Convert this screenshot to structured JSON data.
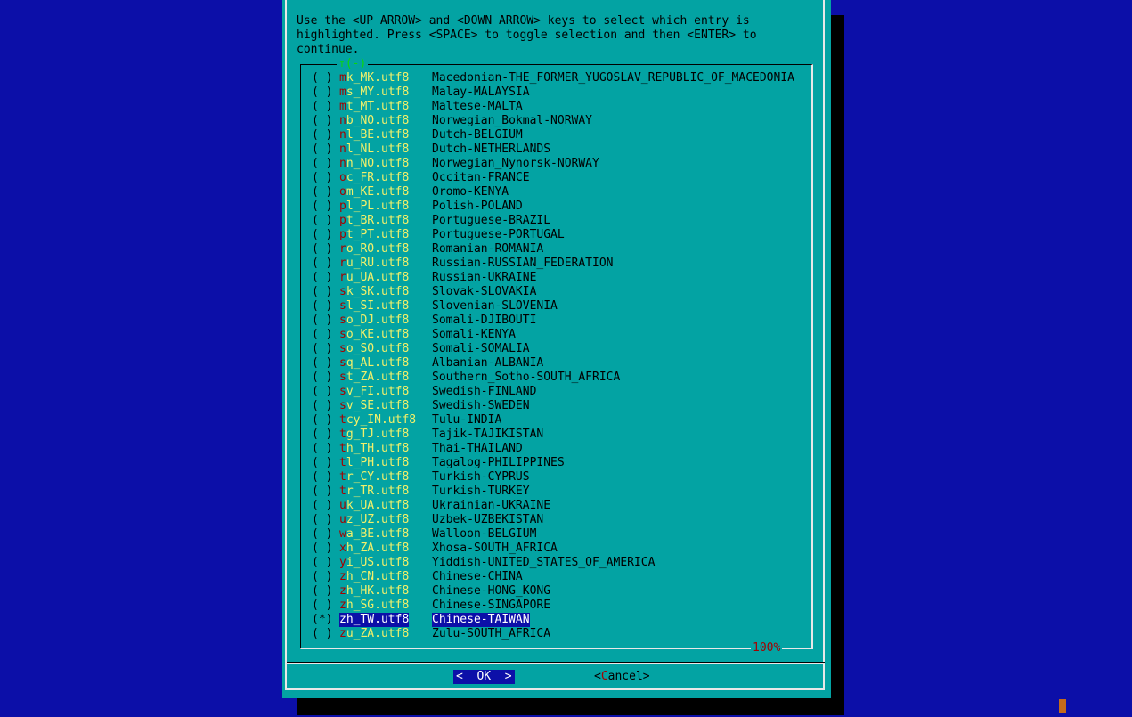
{
  "prompt": "Use the <UP ARROW> and <DOWN ARROW> keys to select which entry is\nhighlighted. Press <SPACE> to toggle selection and then <ENTER> to\ncontinue.",
  "scroll_indicator": "↑(-)",
  "percent": "100%",
  "buttons": {
    "ok": "<  OK  >",
    "cancel_open": "<",
    "cancel_hot": "C",
    "cancel_rest": "ancel>"
  },
  "items": [
    {
      "check": "( )",
      "hot": "m",
      "tag": "k_MK.utf8",
      "desc": "Macedonian-THE_FORMER_YUGOSLAV_REPUBLIC_OF_MACEDONIA"
    },
    {
      "check": "( )",
      "hot": "m",
      "tag": "s_MY.utf8",
      "desc": "Malay-MALAYSIA"
    },
    {
      "check": "( )",
      "hot": "m",
      "tag": "t_MT.utf8",
      "desc": "Maltese-MALTA"
    },
    {
      "check": "( )",
      "hot": "n",
      "tag": "b_NO.utf8",
      "desc": "Norwegian_Bokmal-NORWAY"
    },
    {
      "check": "( )",
      "hot": "n",
      "tag": "l_BE.utf8",
      "desc": "Dutch-BELGIUM"
    },
    {
      "check": "( )",
      "hot": "n",
      "tag": "l_NL.utf8",
      "desc": "Dutch-NETHERLANDS"
    },
    {
      "check": "( )",
      "hot": "n",
      "tag": "n_NO.utf8",
      "desc": "Norwegian_Nynorsk-NORWAY"
    },
    {
      "check": "( )",
      "hot": "o",
      "tag": "c_FR.utf8",
      "desc": "Occitan-FRANCE"
    },
    {
      "check": "( )",
      "hot": "o",
      "tag": "m_KE.utf8",
      "desc": "Oromo-KENYA"
    },
    {
      "check": "( )",
      "hot": "p",
      "tag": "l_PL.utf8",
      "desc": "Polish-POLAND"
    },
    {
      "check": "( )",
      "hot": "p",
      "tag": "t_BR.utf8",
      "desc": "Portuguese-BRAZIL"
    },
    {
      "check": "( )",
      "hot": "p",
      "tag": "t_PT.utf8",
      "desc": "Portuguese-PORTUGAL"
    },
    {
      "check": "( )",
      "hot": "r",
      "tag": "o_RO.utf8",
      "desc": "Romanian-ROMANIA"
    },
    {
      "check": "( )",
      "hot": "r",
      "tag": "u_RU.utf8",
      "desc": "Russian-RUSSIAN_FEDERATION"
    },
    {
      "check": "( )",
      "hot": "r",
      "tag": "u_UA.utf8",
      "desc": "Russian-UKRAINE"
    },
    {
      "check": "( )",
      "hot": "s",
      "tag": "k_SK.utf8",
      "desc": "Slovak-SLOVAKIA"
    },
    {
      "check": "( )",
      "hot": "s",
      "tag": "l_SI.utf8",
      "desc": "Slovenian-SLOVENIA"
    },
    {
      "check": "( )",
      "hot": "s",
      "tag": "o_DJ.utf8",
      "desc": "Somali-DJIBOUTI"
    },
    {
      "check": "( )",
      "hot": "s",
      "tag": "o_KE.utf8",
      "desc": "Somali-KENYA"
    },
    {
      "check": "( )",
      "hot": "s",
      "tag": "o_SO.utf8",
      "desc": "Somali-SOMALIA"
    },
    {
      "check": "( )",
      "hot": "s",
      "tag": "q_AL.utf8",
      "desc": "Albanian-ALBANIA"
    },
    {
      "check": "( )",
      "hot": "s",
      "tag": "t_ZA.utf8",
      "desc": "Southern_Sotho-SOUTH_AFRICA"
    },
    {
      "check": "( )",
      "hot": "s",
      "tag": "v_FI.utf8",
      "desc": "Swedish-FINLAND"
    },
    {
      "check": "( )",
      "hot": "s",
      "tag": "v_SE.utf8",
      "desc": "Swedish-SWEDEN"
    },
    {
      "check": "( )",
      "hot": "t",
      "tag": "cy_IN.utf8",
      "desc": "Tulu-INDIA"
    },
    {
      "check": "( )",
      "hot": "t",
      "tag": "g_TJ.utf8",
      "desc": "Tajik-TAJIKISTAN"
    },
    {
      "check": "( )",
      "hot": "t",
      "tag": "h_TH.utf8",
      "desc": "Thai-THAILAND"
    },
    {
      "check": "( )",
      "hot": "t",
      "tag": "l_PH.utf8",
      "desc": "Tagalog-PHILIPPINES"
    },
    {
      "check": "( )",
      "hot": "t",
      "tag": "r_CY.utf8",
      "desc": "Turkish-CYPRUS"
    },
    {
      "check": "( )",
      "hot": "t",
      "tag": "r_TR.utf8",
      "desc": "Turkish-TURKEY"
    },
    {
      "check": "( )",
      "hot": "u",
      "tag": "k_UA.utf8",
      "desc": "Ukrainian-UKRAINE"
    },
    {
      "check": "( )",
      "hot": "u",
      "tag": "z_UZ.utf8",
      "desc": "Uzbek-UZBEKISTAN"
    },
    {
      "check": "( )",
      "hot": "w",
      "tag": "a_BE.utf8",
      "desc": "Walloon-BELGIUM"
    },
    {
      "check": "( )",
      "hot": "x",
      "tag": "h_ZA.utf8",
      "desc": "Xhosa-SOUTH_AFRICA"
    },
    {
      "check": "( )",
      "hot": "y",
      "tag": "i_US.utf8",
      "desc": "Yiddish-UNITED_STATES_OF_AMERICA"
    },
    {
      "check": "( )",
      "hot": "z",
      "tag": "h_CN.utf8",
      "desc": "Chinese-CHINA"
    },
    {
      "check": "( )",
      "hot": "z",
      "tag": "h_HK.utf8",
      "desc": "Chinese-HONG_KONG"
    },
    {
      "check": "( )",
      "hot": "z",
      "tag": "h_SG.utf8",
      "desc": "Chinese-SINGAPORE"
    },
    {
      "check": "(*)",
      "hot": "z",
      "tag": "h_TW.utf8",
      "desc": "Chinese-TAIWAN",
      "selected": true
    },
    {
      "check": "( )",
      "hot": "z",
      "tag": "u_ZA.utf8",
      "desc": "Zulu-SOUTH_AFRICA"
    }
  ]
}
